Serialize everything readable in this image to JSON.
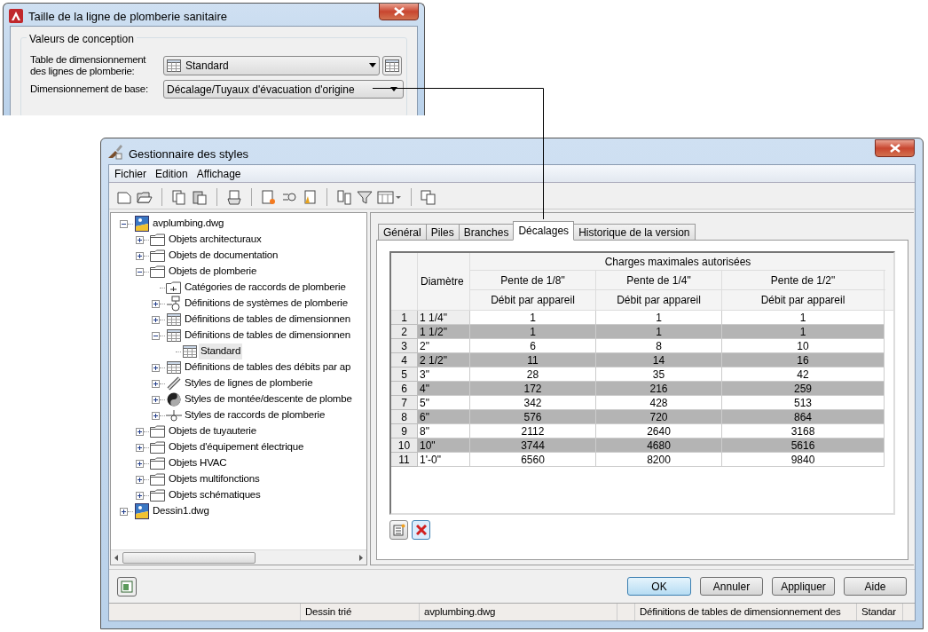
{
  "dialog": {
    "title": "Taille de la ligne de plomberie sanitaire",
    "group_title": "Valeurs de conception",
    "fields": [
      {
        "kind": "table-select",
        "label_lines": [
          "Table de dimensionnement",
          "des lignes de plomberie:"
        ],
        "value": "Standard"
      },
      {
        "kind": "select",
        "label_lines": [
          "Dimensionnement de base:"
        ],
        "value": "Décalage/Tuyaux d'évacuation d'origine"
      }
    ]
  },
  "window": {
    "title": "Gestionnaire des styles"
  },
  "menu": [
    "Fichier",
    "Edition",
    "Affichage"
  ],
  "tree": [
    {
      "label": "avplumbing.dwg",
      "kind": "drawing",
      "expanded": true,
      "selected": false,
      "children": [
        {
          "label": "Objets architecturaux",
          "kind": "folder",
          "expanded": false,
          "selected": false
        },
        {
          "label": "Objets de documentation",
          "kind": "folder",
          "expanded": false,
          "selected": false
        },
        {
          "label": "Objets de plomberie",
          "kind": "folder",
          "expanded": true,
          "selected": false,
          "children": [
            {
              "label": "Catégories de raccords de plomberie",
              "kind": "category",
              "selected": false
            },
            {
              "label": "Définitions de systèmes de plomberie",
              "kind": "system",
              "expanded": false,
              "selected": false
            },
            {
              "label": "Définitions de tables de dimensionnen",
              "kind": "table",
              "expanded": false,
              "selected": false
            },
            {
              "label": "Définitions de tables de dimensionnen",
              "kind": "table",
              "expanded": true,
              "selected": false,
              "children": [
                {
                  "label": "Standard",
                  "kind": "table",
                  "selected": true
                }
              ]
            },
            {
              "label": "Définitions de tables des débits par ap",
              "kind": "table",
              "expanded": false,
              "selected": false
            },
            {
              "label": "Styles de lignes de plomberie",
              "kind": "pipe",
              "expanded": false,
              "selected": false
            },
            {
              "label": "Styles de montée/descente de plombe",
              "kind": "riser",
              "expanded": false,
              "selected": false
            },
            {
              "label": "Styles de raccords de plomberie",
              "kind": "fitting",
              "expanded": false,
              "selected": false
            }
          ]
        },
        {
          "label": "Objets de tuyauterie",
          "kind": "folder",
          "expanded": false,
          "selected": false
        },
        {
          "label": "Objets d'équipement électrique",
          "kind": "folder",
          "expanded": false,
          "selected": false
        },
        {
          "label": "Objets HVAC",
          "kind": "folder",
          "expanded": false,
          "selected": false
        },
        {
          "label": "Objets multifonctions",
          "kind": "folder",
          "expanded": false,
          "selected": false
        },
        {
          "label": "Objets schématiques",
          "kind": "folder",
          "expanded": false,
          "selected": false
        }
      ]
    },
    {
      "label": "Dessin1.dwg",
      "kind": "drawing",
      "expanded": false,
      "selected": false
    }
  ],
  "tabs": [
    {
      "label": "Général",
      "selected": false
    },
    {
      "label": "Piles",
      "selected": false
    },
    {
      "label": "Branches",
      "selected": false
    },
    {
      "label": "Décalages",
      "selected": true
    },
    {
      "label": "Historique de la version",
      "selected": false
    }
  ],
  "table": {
    "diameter_header": "Diamètre",
    "group_header": "Charges maximales autorisées",
    "columns": [
      {
        "slope": "Pente de 1/8\"",
        "sub": "Débit par appareil"
      },
      {
        "slope": "Pente de 1/4\"",
        "sub": "Débit par appareil"
      },
      {
        "slope": "Pente de 1/2\"",
        "sub": "Débit par appareil"
      }
    ],
    "rows": [
      {
        "number": "1",
        "diameter": "1 1/4\"",
        "values": [
          "1",
          "1",
          "1"
        ]
      },
      {
        "number": "2",
        "diameter": "1 1/2\"",
        "values": [
          "1",
          "1",
          "1"
        ]
      },
      {
        "number": "3",
        "diameter": "2\"",
        "values": [
          "6",
          "8",
          "10"
        ]
      },
      {
        "number": "4",
        "diameter": "2 1/2\"",
        "values": [
          "11",
          "14",
          "16"
        ]
      },
      {
        "number": "5",
        "diameter": "3\"",
        "values": [
          "28",
          "35",
          "42"
        ]
      },
      {
        "number": "6",
        "diameter": "4\"",
        "values": [
          "172",
          "216",
          "259"
        ]
      },
      {
        "number": "7",
        "diameter": "5\"",
        "values": [
          "342",
          "428",
          "513"
        ]
      },
      {
        "number": "8",
        "diameter": "6\"",
        "values": [
          "576",
          "720",
          "864"
        ]
      },
      {
        "number": "9",
        "diameter": "8\"",
        "values": [
          "2112",
          "2640",
          "3168"
        ]
      },
      {
        "number": "10",
        "diameter": "10\"",
        "values": [
          "3744",
          "4680",
          "5616"
        ]
      },
      {
        "number": "11",
        "diameter": "1'-0\"",
        "values": [
          "6560",
          "8200",
          "9840"
        ]
      }
    ]
  },
  "buttons": [
    {
      "label": "OK",
      "default": true
    },
    {
      "label": "Annuler",
      "default": false
    },
    {
      "label": "Appliquer",
      "default": false
    },
    {
      "label": "Aide",
      "default": false
    }
  ],
  "status_bar": [
    "Dessin trié",
    "avplumbing.dwg",
    "Définitions de tables de dimensionnement des",
    "Standar"
  ]
}
